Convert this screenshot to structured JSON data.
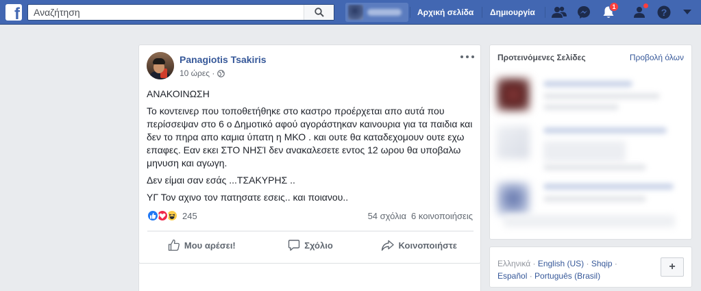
{
  "topbar": {
    "logo": "f",
    "search_placeholder": "Αναζήτηση",
    "nav_home": "Αρχική σελίδα",
    "nav_create": "Δημιουργία",
    "notifications_count": "1",
    "brand_color": "#4267b2"
  },
  "post": {
    "author": "Panagiotis Tsakiris",
    "time": "10 ώρες ·",
    "privacy_icon": "globe-icon",
    "paragraphs": [
      "ΑΝΑΚΟΙΝΩΣΗ",
      "Το κοντεινερ που τοποθετήθηκε στο καστρο προέρχεται απο αυτά που περίσσεψαν στο 6 ο Δημοτικό αφού αγοράστηκαν καινουρια για τα παιδια και δεν το πηρα απο καμια ύπατη η ΜΚΟ . και ουτε θα καταδεχομουν ουτε εχω επαφες. Εαν εκει ΣΤΟ ΝΗΣΊ δεν ανακαλεσετε εντος 12 ωρου θα υποβαλω μηνυση και αγωγη.",
      "Δεν είμαι σαν εσάς ...ΤΣΑΚΥΡΗΣ ..",
      "ΥΓ Τον αχινο τον πατησατε εσεις.. και ποιανου.."
    ],
    "reactions_count": "245",
    "comments": "54 σχόλια",
    "shares": "6 κοινοποιήσεις",
    "actions": {
      "like": "Μου αρέσει!",
      "comment": "Σχόλιο",
      "share": "Κοινοποιήστε"
    }
  },
  "sidebar": {
    "suggested_title": "Προτεινόμενες Σελίδες",
    "see_all": "Προβολή όλων"
  },
  "footer": {
    "languages": [
      "Ελληνικά",
      "English (US)",
      "Shqip",
      "Español",
      "Português (Brasil)"
    ],
    "add_button": "+"
  }
}
